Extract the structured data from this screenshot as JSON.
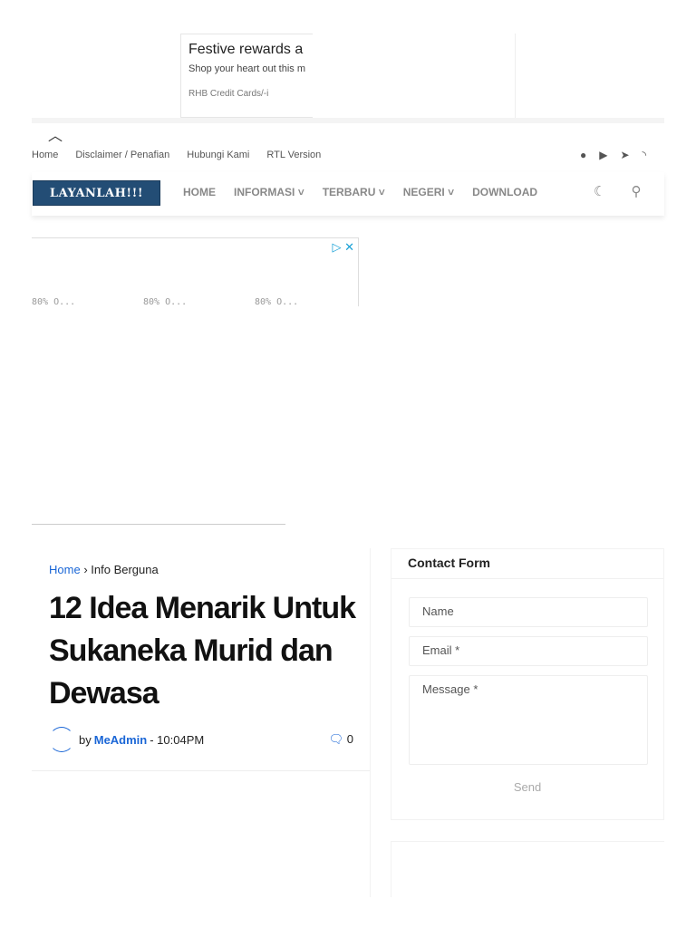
{
  "ad_top": {
    "title": "Festive rewards a",
    "subtitle": "Shop your heart out this m",
    "brand": "RHB Credit Cards/-i"
  },
  "top_nav": [
    "Home",
    "Disclaimer / Penafian",
    "Hubungi Kami",
    "RTL Version"
  ],
  "social": [
    "facebook-icon",
    "youtube-icon",
    "telegram-icon",
    "rss-icon"
  ],
  "logo": "LAYANLAH!!!",
  "main_nav": [
    "HOME",
    "INFORMASI",
    "TERBARU",
    "NEGERI",
    "DOWNLOAD"
  ],
  "ad_bottom": {
    "items": [
      "80% O...",
      "80% O...",
      "80% O..."
    ]
  },
  "breadcrumb": {
    "home": "Home",
    "sep": "›",
    "current": "Info Berguna"
  },
  "post": {
    "title": "12 Idea Menarik Untuk Sukaneka Murid dan Dewasa",
    "by": "by",
    "author": "MeAdmin",
    "time": "- 10:04PM",
    "comments": "0"
  },
  "contact": {
    "title": "Contact Form",
    "name": "Name",
    "email": "Email *",
    "message": "Message *",
    "send": "Send"
  }
}
